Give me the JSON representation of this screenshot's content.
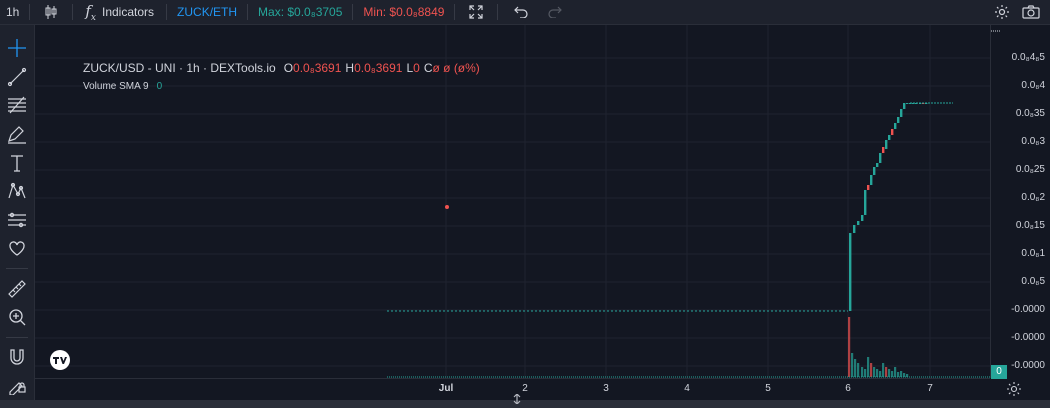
{
  "toolbar": {
    "interval": "1h",
    "indicators_label": "Indicators",
    "pair": "ZUCK/ETH",
    "max_label": "Max: $0.0₈3705",
    "min_label": "Min: $0.0₈8849"
  },
  "legend": {
    "title": "ZUCK/USD - UNI · 1h · DEXTools.io",
    "o_label": "O",
    "o_value": "0.0₈3691",
    "h_label": "H",
    "h_value": "0.0₈3691",
    "l_label": "L",
    "l_value": "0",
    "c_label": "C",
    "c_value": "ø ø (ø%)",
    "volume_label": "Volume SMA 9",
    "volume_value": "0"
  },
  "price_axis": {
    "labels": [
      "0.0₈4₈5",
      "0.0₈4",
      "0.0₈35",
      "0.0₈3",
      "0.0₈25",
      "0.0₈2",
      "0.0₈15",
      "0.0₈1",
      "0.0₈5",
      "-0.0000",
      "-0.0000",
      "-0.0000"
    ],
    "current_badge": "0"
  },
  "time_axis": {
    "labels": [
      "Jul",
      "2",
      "3",
      "4",
      "5",
      "6",
      "7"
    ]
  },
  "colors": {
    "up": "#26a69a",
    "down": "#ef5350",
    "background": "#131722",
    "accent": "#2196f3"
  },
  "icons": [
    "crosshair-icon",
    "trend-line-icon",
    "fib-icon",
    "brush-icon",
    "text-icon",
    "pattern-icon",
    "projection-icon",
    "heart-icon",
    "ruler-icon",
    "zoom-icon",
    "magnet-icon",
    "lock-draw-icon"
  ]
}
